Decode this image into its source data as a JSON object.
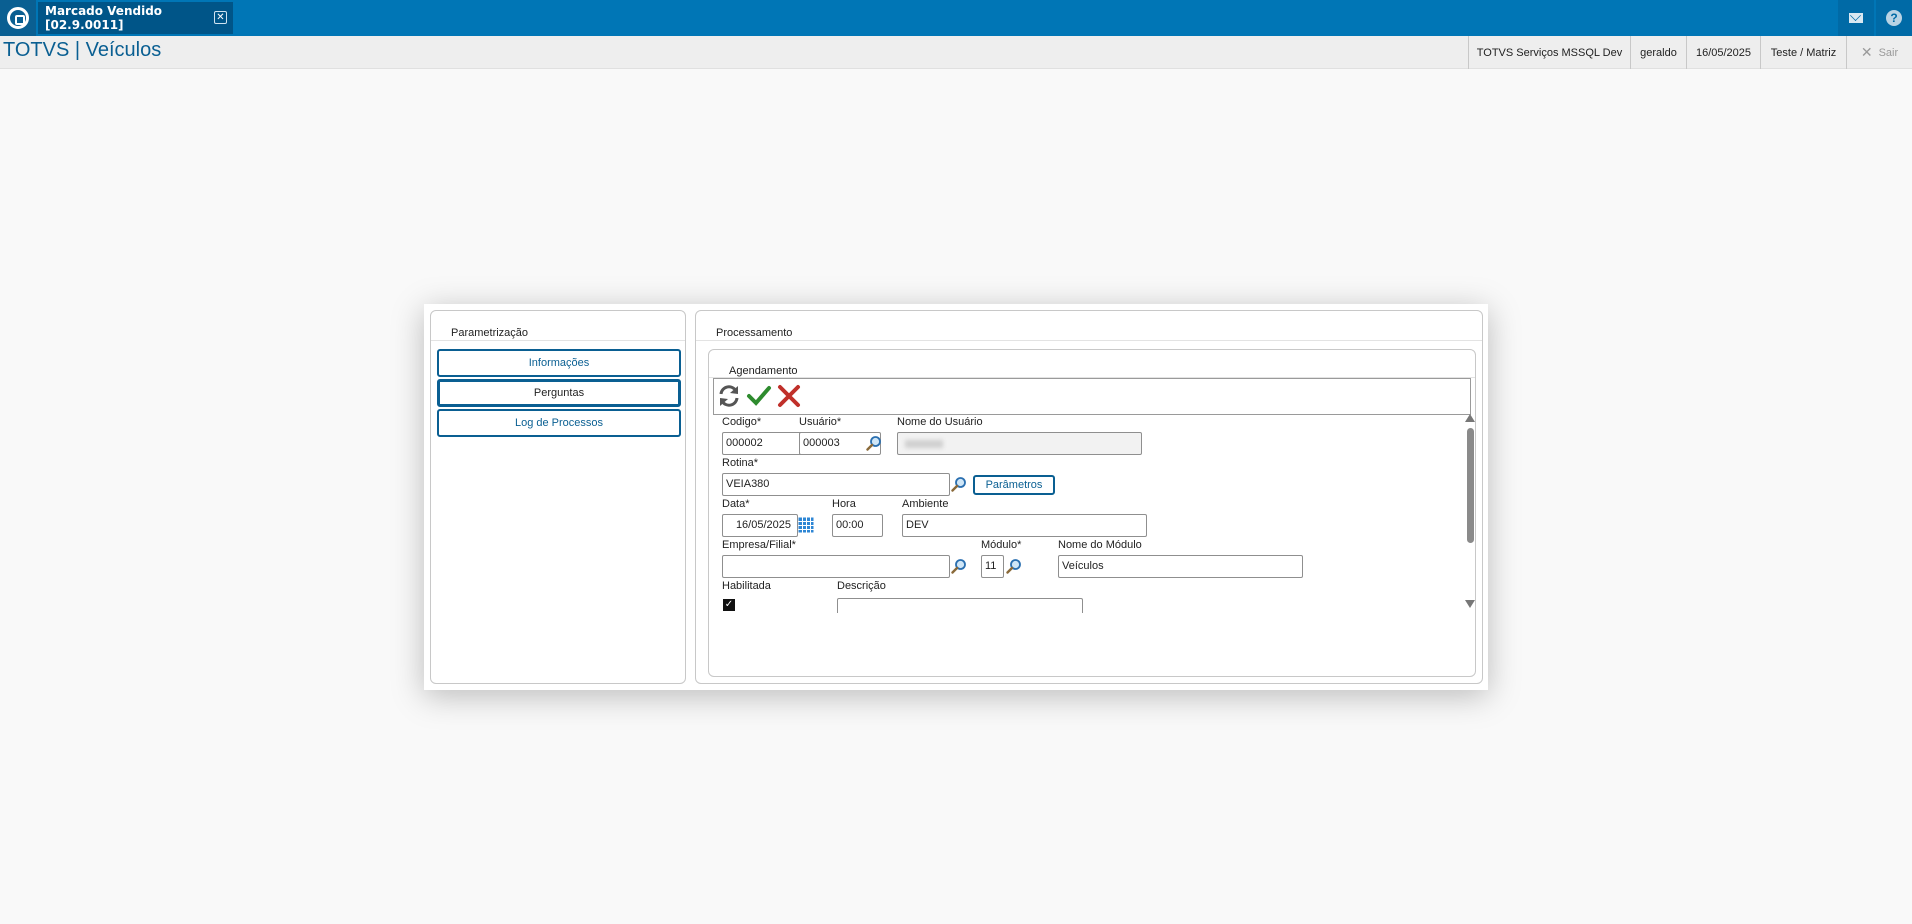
{
  "topbar": {
    "tab_label": "Marcado Vendido [02.9.0011]",
    "icons": [
      "totvs-logo-icon",
      "close-icon",
      "mail-icon",
      "help-icon"
    ]
  },
  "header": {
    "title": "TOTVS | Veículos",
    "environment": "TOTVS Serviços MSSQL Dev",
    "user": "geraldo",
    "date": "16/05/2025",
    "branch": "Teste / Matriz",
    "logout_label": "Sair"
  },
  "left_panel": {
    "title": "Parametrização",
    "buttons": [
      "Informações",
      "Perguntas",
      "Log de Processos"
    ],
    "active": "Perguntas"
  },
  "right_panel": {
    "title": "Processamento",
    "section_title": "Agendamento",
    "toolbar_icons": [
      "refresh-icon",
      "confirm-icon",
      "cancel-icon"
    ]
  },
  "form": {
    "codigo_label": "Codigo*",
    "codigo_value": "000002",
    "usuario_label": "Usuário*",
    "usuario_value": "000003",
    "nome_usuario_label": "Nome do Usuário",
    "rotina_label": "Rotina*",
    "rotina_value": "VEIA380",
    "parametros_label": "Parâmetros",
    "data_label": "Data*",
    "data_value": "16/05/2025",
    "hora_label": "Hora",
    "hora_value": "00:00",
    "ambiente_label": "Ambiente",
    "ambiente_value": "DEV",
    "empresa_label": "Empresa/Filial*",
    "empresa_value": "",
    "modulo_label": "Módulo*",
    "modulo_value": "11",
    "nome_modulo_label": "Nome do Módulo",
    "nome_modulo_value": "Veículos",
    "habilitada_label": "Habilitada",
    "habilitada_checked": true,
    "descricao_label": "Descrição",
    "descricao_value": ""
  },
  "colors": {
    "brand": "#0076b6",
    "accent": "#0a5f92"
  }
}
